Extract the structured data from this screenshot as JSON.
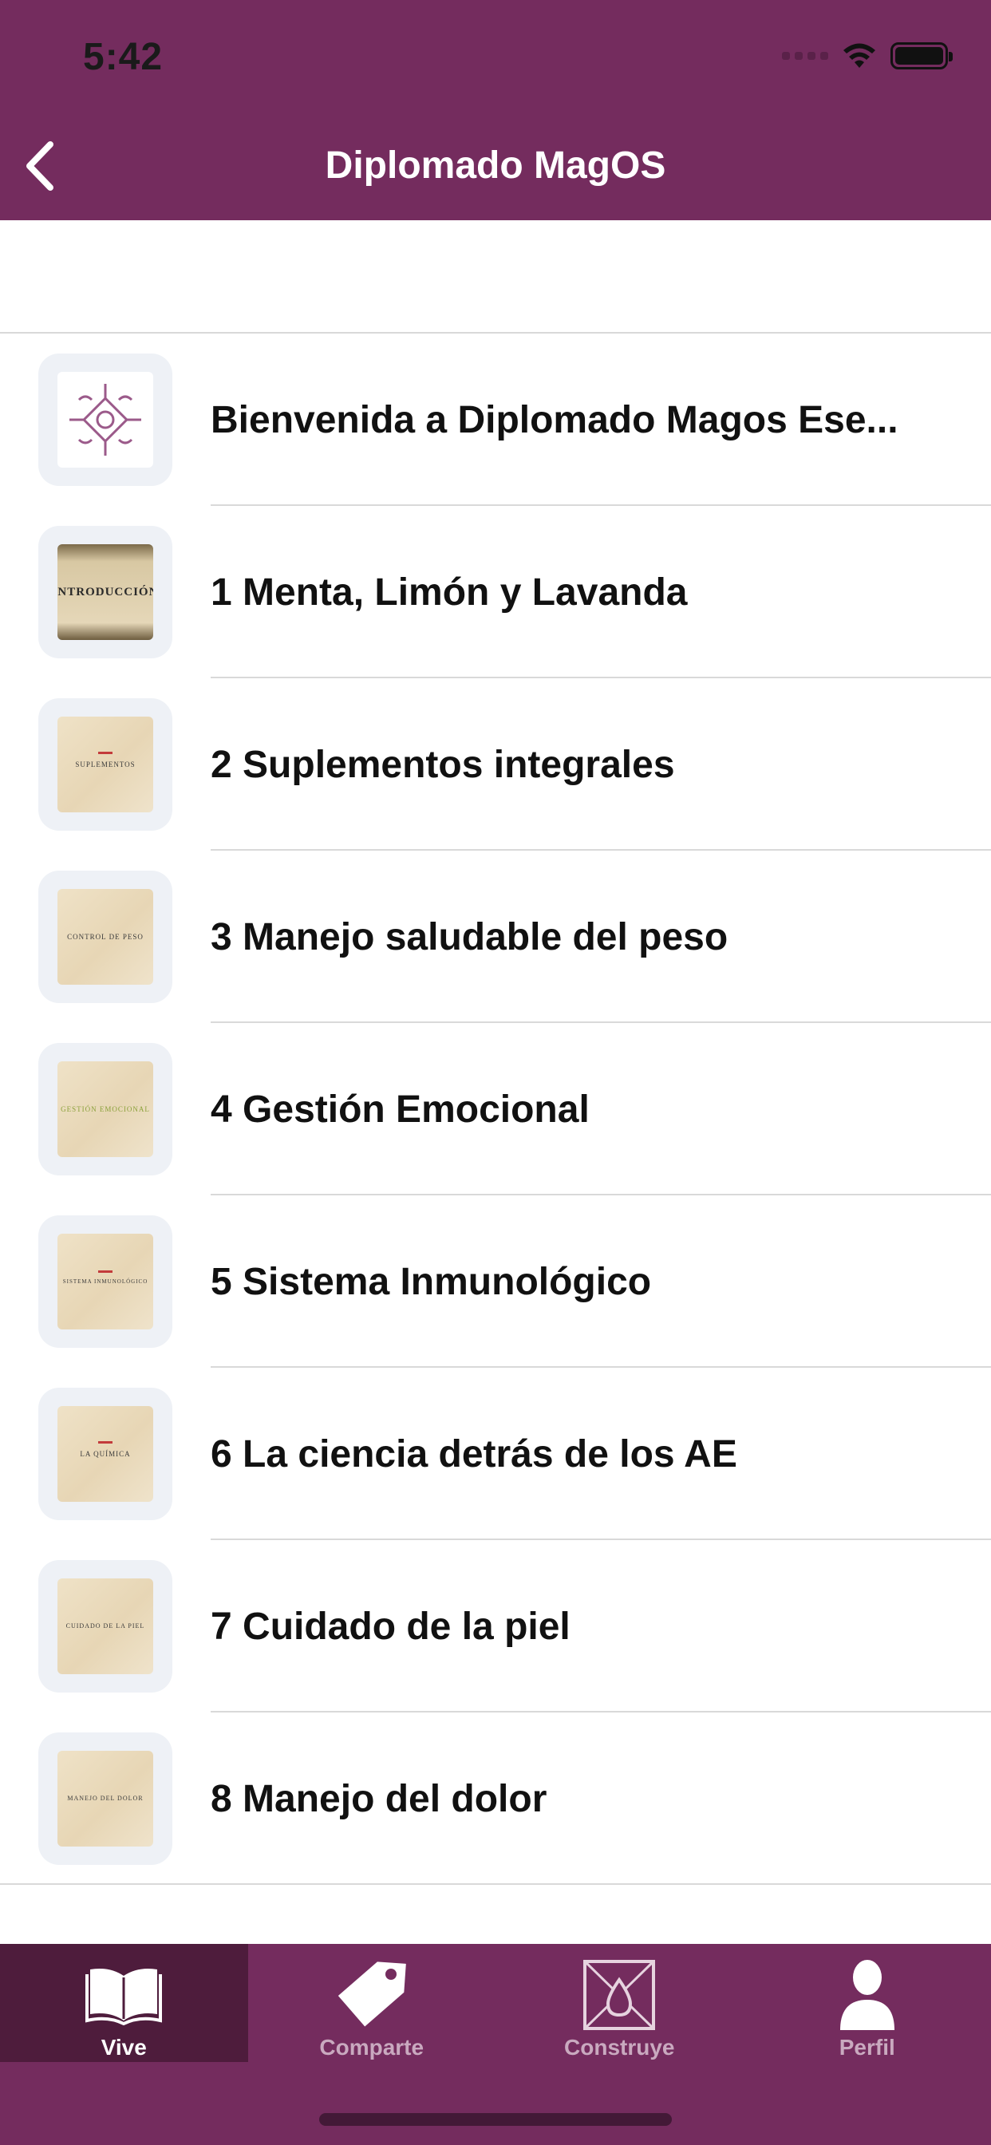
{
  "status_bar": {
    "time": "5:42"
  },
  "nav": {
    "title": "Diplomado MagOS"
  },
  "lessons": [
    {
      "label": "Bienvenida a Diplomado Magos Ese...",
      "thumb_icon": "magos-logo-icon"
    },
    {
      "label": "1 Menta, Limón y Lavanda",
      "thumb_text": "INTRODUCCIÓN"
    },
    {
      "label": "2 Suplementos integrales",
      "thumb_text": "SUPLEMENTOS"
    },
    {
      "label": "3 Manejo saludable del peso",
      "thumb_text": "CONTROL DE PESO"
    },
    {
      "label": "4 Gestión Emocional",
      "thumb_text": "GESTIÓN EMOCIONAL"
    },
    {
      "label": "5 Sistema Inmunológico",
      "thumb_text": "SISTEMA INMUNOLÓGICO"
    },
    {
      "label": "6 La ciencia detrás de los AE",
      "thumb_text": "LA QUÍMICA"
    },
    {
      "label": "7 Cuidado de la piel",
      "thumb_text": "CUIDADO DE LA PIEL"
    },
    {
      "label": "8 Manejo del dolor",
      "thumb_text": "MANEJO DEL DOLOR"
    }
  ],
  "tabs": [
    {
      "label": "Vive",
      "icon": "open-book-icon",
      "active": true
    },
    {
      "label": "Comparte",
      "icon": "tag-icon",
      "active": false
    },
    {
      "label": "Construye",
      "icon": "drop-box-icon",
      "active": false
    },
    {
      "label": "Perfil",
      "icon": "person-icon",
      "active": false
    }
  ],
  "colors": {
    "brand": "#742c5e",
    "tab_active": "#4e1c3c"
  }
}
